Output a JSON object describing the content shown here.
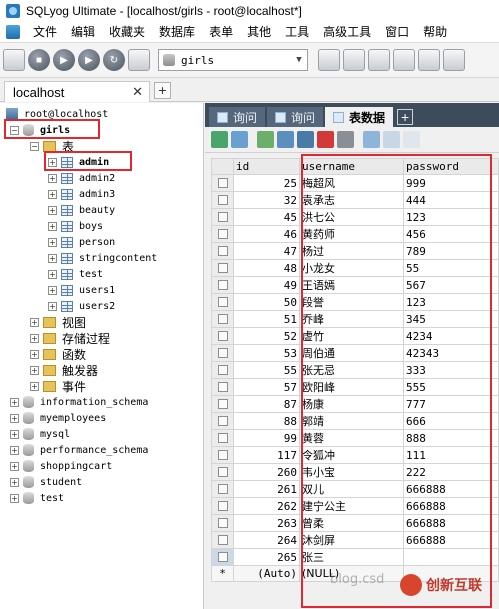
{
  "window": {
    "title": "SQLyog Ultimate - [localhost/girls - root@localhost*]"
  },
  "menu": [
    "文件",
    "编辑",
    "收藏夹",
    "数据库",
    "表单",
    "其他",
    "工具",
    "高级工具",
    "窗口",
    "帮助"
  ],
  "toolbar": {
    "database": "girls"
  },
  "connection_tab": {
    "label": "localhost",
    "close": "✕",
    "add": "+"
  },
  "tree": {
    "server": "root@localhost",
    "database": "girls",
    "tables_folder": "表",
    "tables": [
      "admin",
      "admin2",
      "admin3",
      "beauty",
      "boys",
      "person",
      "stringcontent",
      "test",
      "users1",
      "users2"
    ],
    "folders": [
      "视图",
      "存储过程",
      "函数",
      "触发器",
      "事件"
    ],
    "other_databases": [
      "information_schema",
      "myemployees",
      "mysql",
      "performance_schema",
      "shoppingcart",
      "student",
      "test"
    ]
  },
  "result_tabs": [
    {
      "label": "询问",
      "active": false
    },
    {
      "label": "询问",
      "active": false
    },
    {
      "label": "表数据",
      "active": true
    }
  ],
  "grid": {
    "columns": [
      "id",
      "username",
      "password"
    ],
    "rows": [
      [
        "25",
        "梅超风",
        "999"
      ],
      [
        "32",
        "袁承志",
        "444"
      ],
      [
        "45",
        "洪七公",
        "123"
      ],
      [
        "46",
        "黄药师",
        "456"
      ],
      [
        "47",
        "杨过",
        "789"
      ],
      [
        "48",
        "小龙女",
        "55"
      ],
      [
        "49",
        "王语嫣",
        "567"
      ],
      [
        "50",
        "段誉",
        "123"
      ],
      [
        "51",
        "乔峰",
        "345"
      ],
      [
        "52",
        "虚竹",
        "4234"
      ],
      [
        "53",
        "周伯通",
        "42343"
      ],
      [
        "55",
        "张无忌",
        "333"
      ],
      [
        "57",
        "欧阳峰",
        "555"
      ],
      [
        "87",
        "杨康",
        "777"
      ],
      [
        "88",
        "郭靖",
        "666"
      ],
      [
        "99",
        "黄蓉",
        "888"
      ],
      [
        "117",
        "令狐冲",
        "111"
      ],
      [
        "260",
        "韦小宝",
        "222"
      ],
      [
        "261",
        "双儿",
        "666888"
      ],
      [
        "262",
        "建宁公主",
        "666888"
      ],
      [
        "263",
        "曾柔",
        "666888"
      ],
      [
        "264",
        "沐剑屏",
        "666888"
      ],
      [
        "265",
        "张三",
        ""
      ]
    ],
    "new_row": {
      "marker": "*",
      "id": "(Auto)",
      "username": "(NULL)"
    }
  },
  "watermark": "blog.csd",
  "brand": "创新互联"
}
